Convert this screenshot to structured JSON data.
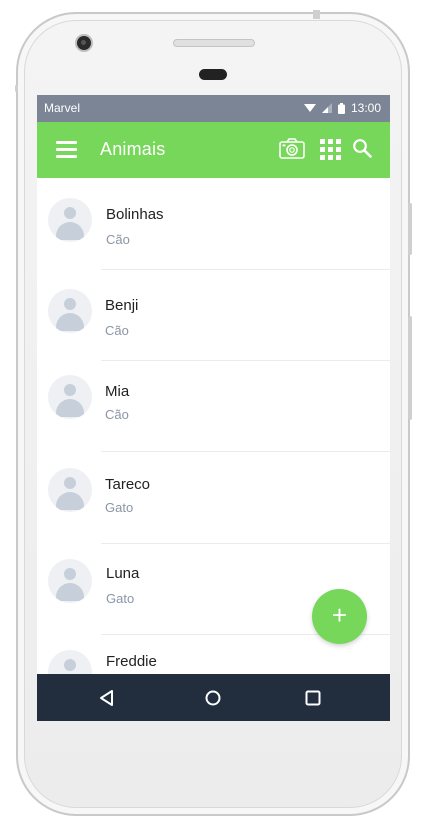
{
  "status_bar": {
    "carrier": "Marvel",
    "time": "13:00"
  },
  "app_bar": {
    "title": "Animais",
    "icons": [
      "menu-icon",
      "camera-icon",
      "grid-icon",
      "search-icon"
    ],
    "color": "#76d75a"
  },
  "animals": [
    {
      "name": "Bolinhas",
      "type": "Cão"
    },
    {
      "name": "Benji",
      "type": "Cão"
    },
    {
      "name": "Mia",
      "type": "Cão"
    },
    {
      "name": "Tareco",
      "type": "Gato"
    },
    {
      "name": "Luna",
      "type": "Gato"
    },
    {
      "name": "Freddie",
      "type": ""
    }
  ],
  "fab": {
    "label": "+"
  },
  "nav_bar": {
    "icons": [
      "back-icon",
      "home-icon",
      "recents-icon"
    ],
    "color": "#222e3e"
  }
}
